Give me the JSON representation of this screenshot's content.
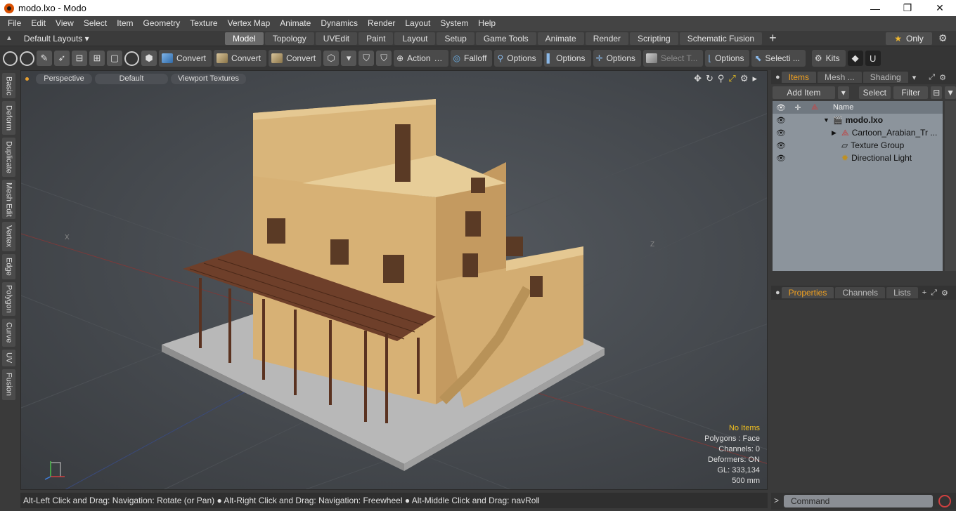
{
  "window": {
    "title": "modo.lxo - Modo",
    "min_icon": "minimize-icon",
    "max_icon": "maximize-icon",
    "close_icon": "close-icon"
  },
  "menu": [
    "File",
    "Edit",
    "View",
    "Select",
    "Item",
    "Geometry",
    "Texture",
    "Vertex Map",
    "Animate",
    "Dynamics",
    "Render",
    "Layout",
    "System",
    "Help"
  ],
  "layouts": {
    "label": "Default Layouts ▾"
  },
  "tabs": [
    "Model",
    "Topology",
    "UVEdit",
    "Paint",
    "Layout",
    "Setup",
    "Game Tools",
    "Animate",
    "Render",
    "Scripting",
    "Schematic Fusion"
  ],
  "only_label": "Only",
  "toolbar": {
    "convert1": "Convert",
    "convert2": "Convert",
    "convert3": "Convert",
    "action": "Action",
    "falloff": "Falloff",
    "options1": "Options",
    "options2": "Options",
    "options3": "Options",
    "select_t": "Select T...",
    "options4": "Options",
    "selecti": "Selecti ...",
    "kits": "Kits"
  },
  "left_tabs": [
    "Basic",
    "Deform",
    "Duplicate",
    "Mesh Edit",
    "Vertex",
    "Edge",
    "Polygon",
    "Curve",
    "UV",
    "Fusion"
  ],
  "viewport": {
    "view": "Perspective",
    "style": "Default",
    "textures": "Viewport Textures",
    "info": {
      "items": "No Items",
      "polygons": "Polygons : Face",
      "channels": "Channels: 0",
      "deformers": "Deformers: ON",
      "gl": "GL: 333,134",
      "scale": "500 mm"
    },
    "axis_x": "X",
    "axis_z": "Z"
  },
  "items_panel": {
    "tabs": [
      "Items",
      "Mesh ...",
      "Shading"
    ],
    "add_item": "Add Item",
    "select": "Select",
    "filter": "Filter",
    "col_name": "Name",
    "rows": [
      {
        "name": "modo.lxo",
        "bold": true
      },
      {
        "name": "Cartoon_Arabian_Tr ..."
      },
      {
        "name": "Texture Group"
      },
      {
        "name": "Directional Light"
      }
    ]
  },
  "props_panel": {
    "tabs": [
      "Properties",
      "Channels",
      "Lists"
    ]
  },
  "status": {
    "text": "Alt-Left Click and Drag: Navigation: Rotate (or Pan) ● Alt-Right Click and Drag: Navigation: Freewheel ● Alt-Middle Click and Drag: navRoll"
  },
  "command": {
    "placeholder": "Command"
  }
}
